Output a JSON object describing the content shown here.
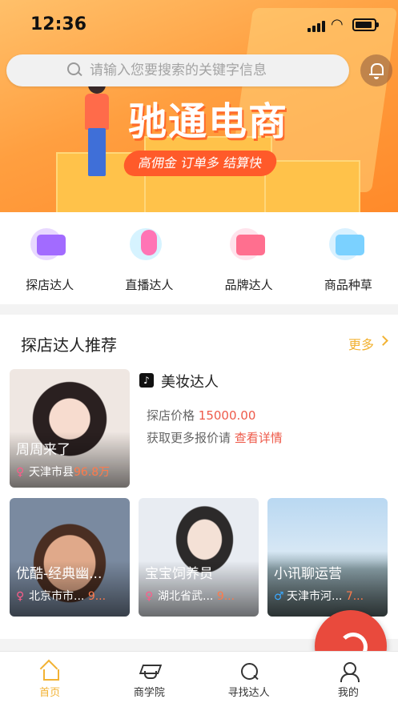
{
  "status_bar": {
    "time": "12:36"
  },
  "banner": {
    "title": "驰通电商",
    "subtitle": "高佣金 订单多 结算快"
  },
  "search": {
    "placeholder": "请输入您要搜索的关键字信息"
  },
  "categories": [
    {
      "label": "探店达人",
      "icon": "shop-screen-icon",
      "color": "#a26bff"
    },
    {
      "label": "直播达人",
      "icon": "microphone-icon",
      "color": "#ff74b5"
    },
    {
      "label": "品牌达人",
      "icon": "radio-box-icon",
      "color": "#ff6f8f"
    },
    {
      "label": "商品种草",
      "icon": "map-pin-icon",
      "color": "#7bd1ff"
    }
  ],
  "section": {
    "title": "探店达人推荐",
    "more_label": "更多",
    "featured": {
      "name": "周周来了",
      "location": "天津市县",
      "value": "96.8万",
      "category_label": "美妆达人",
      "price_label": "探店价格",
      "price": "15000.00",
      "tip_label": "获取更多报价请",
      "tip_link": "查看详情"
    },
    "cards": [
      {
        "name": "优酷-经典幽...",
        "location": "北京市市...",
        "value": "9...",
        "gender": "female"
      },
      {
        "name": "宝宝饲养员",
        "location": "湖北省武...",
        "value": "9...",
        "gender": "female"
      },
      {
        "name": "小讯聊运营",
        "location": "天津市河...",
        "value": "7...",
        "gender": "male"
      }
    ]
  },
  "tabs": [
    {
      "label": "首页",
      "icon": "home-icon",
      "active": true
    },
    {
      "label": "商学院",
      "icon": "graduation-cap-icon",
      "active": false
    },
    {
      "label": "寻找达人",
      "icon": "search-person-icon",
      "active": false
    },
    {
      "label": "我的",
      "icon": "user-icon",
      "active": false
    }
  ],
  "colors": {
    "accent": "#f2b233",
    "price_red": "#ee5a4a",
    "banner_orange": "#ff9f40",
    "fab_red": "#e94a3d"
  }
}
